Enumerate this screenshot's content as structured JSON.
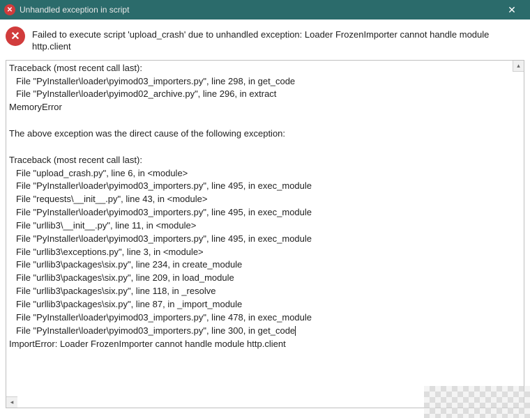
{
  "titlebar": {
    "title": "Unhandled exception in script"
  },
  "message": "Failed to execute script 'upload_crash' due to unhandled exception: Loader FrozenImporter cannot handle module http.client",
  "traceback": {
    "lines": [
      {
        "text": "Traceback (most recent call last):",
        "indent": false
      },
      {
        "text": "File \"PyInstaller\\loader\\pyimod03_importers.py\", line 298, in get_code",
        "indent": true
      },
      {
        "text": "File \"PyInstaller\\loader\\pyimod02_archive.py\", line 296, in extract",
        "indent": true
      },
      {
        "text": "MemoryError",
        "indent": false
      },
      {
        "text": "",
        "indent": false
      },
      {
        "text": "The above exception was the direct cause of the following exception:",
        "indent": false
      },
      {
        "text": "",
        "indent": false
      },
      {
        "text": "Traceback (most recent call last):",
        "indent": false
      },
      {
        "text": "File \"upload_crash.py\", line 6, in <module>",
        "indent": true
      },
      {
        "text": "File \"PyInstaller\\loader\\pyimod03_importers.py\", line 495, in exec_module",
        "indent": true
      },
      {
        "text": "File \"requests\\__init__.py\", line 43, in <module>",
        "indent": true
      },
      {
        "text": "File \"PyInstaller\\loader\\pyimod03_importers.py\", line 495, in exec_module",
        "indent": true
      },
      {
        "text": "File \"urllib3\\__init__.py\", line 11, in <module>",
        "indent": true
      },
      {
        "text": "File \"PyInstaller\\loader\\pyimod03_importers.py\", line 495, in exec_module",
        "indent": true
      },
      {
        "text": "File \"urllib3\\exceptions.py\", line 3, in <module>",
        "indent": true
      },
      {
        "text": "File \"urllib3\\packages\\six.py\", line 234, in create_module",
        "indent": true
      },
      {
        "text": "File \"urllib3\\packages\\six.py\", line 209, in load_module",
        "indent": true
      },
      {
        "text": "File \"urllib3\\packages\\six.py\", line 118, in _resolve",
        "indent": true
      },
      {
        "text": "File \"urllib3\\packages\\six.py\", line 87, in _import_module",
        "indent": true
      },
      {
        "text": "File \"PyInstaller\\loader\\pyimod03_importers.py\", line 478, in exec_module",
        "indent": true
      },
      {
        "text": "File \"PyInstaller\\loader\\pyimod03_importers.py\", line 300, in get_code",
        "indent": true,
        "caret": true
      },
      {
        "text": "ImportError: Loader FrozenImporter cannot handle module http.client",
        "indent": false
      }
    ]
  }
}
